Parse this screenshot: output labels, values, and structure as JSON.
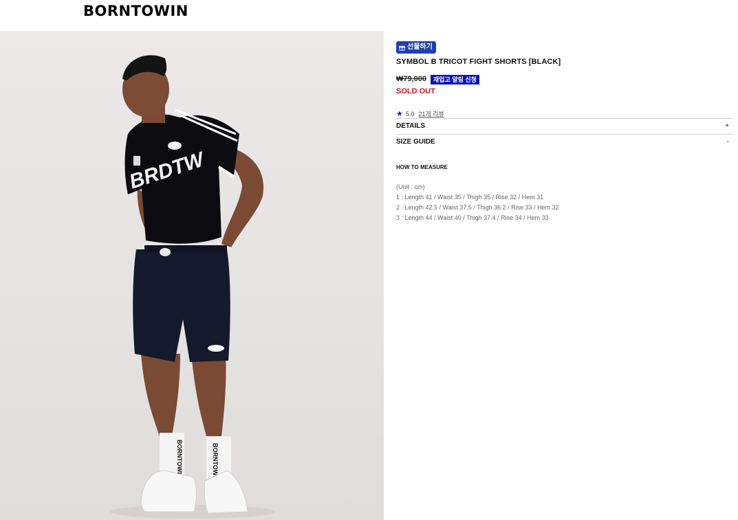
{
  "brand": {
    "logo": "BORNTOWIN"
  },
  "product": {
    "gift_label": "선물하기",
    "title": "SYMBOL B TRICOT FIGHT SHORTS [BLACK]",
    "price": "₩79,000",
    "restock_label": "재입고 알림 신청",
    "status": "SOLD OUT",
    "rating": "5.0",
    "reviews_link": "21개 리뷰"
  },
  "accordion": [
    {
      "label": "DETAILS",
      "toggle": "+"
    },
    {
      "label": "SIZE GUIDE",
      "toggle": "-"
    }
  ],
  "size_guide": {
    "heading": "HOW TO MEASURE",
    "unit": "(Unit : cm)",
    "rows": [
      "1 : Length 41 / Waist 35 / Thigh 35 / Rise 32 / Hem 31",
      "2 : Length 42.5 / Waist 37.5 / Thigh 36.2 / Rise 33 / Hem 32",
      "3 : Length 44 / Waist 40 / Thigh 37.4 / Rise 34 / Hem 33"
    ]
  },
  "photo": {
    "shirt_text": "BRDTW",
    "sock_text": "BORNTOWIN"
  },
  "colors": {
    "gift_button": "#1f3fb3",
    "restock_button": "#0a14b8",
    "soldout": "#c4171d",
    "star": "#1a1ad6"
  }
}
